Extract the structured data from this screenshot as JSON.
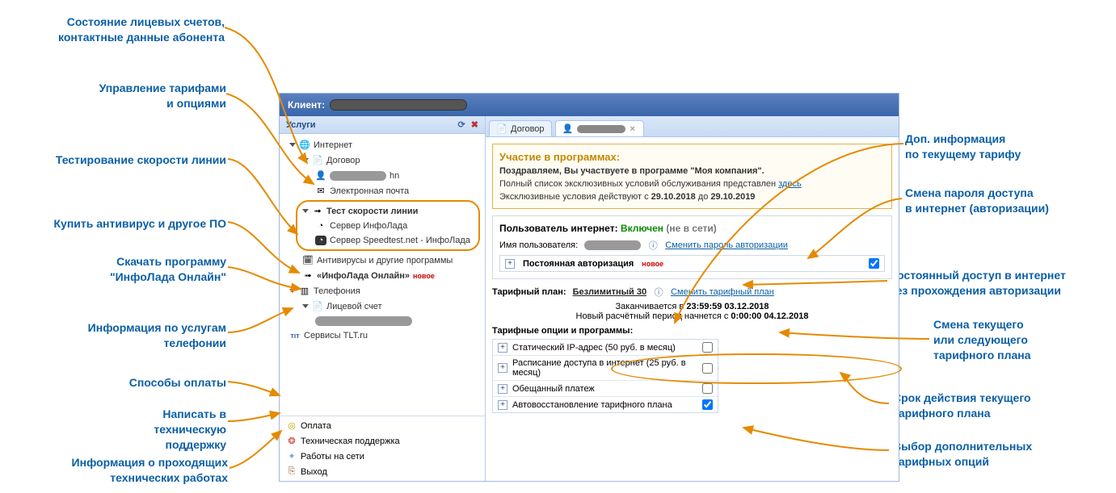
{
  "callouts": {
    "balance": "Состояние лицевых счетов,\nконтактные данные абонента",
    "tariffs": "Управление тарифами\nи опциями",
    "speedtest": "Тестирование скорости линии",
    "antivirus": "Купить антивирус и другое ПО",
    "download": "Скачать программу\n\"ИнфоЛада Онлайн\"",
    "telephony": "Информация по услугам\nтелефонии",
    "payment": "Способы оплаты",
    "support": "Написать в\nтехническую поддержку",
    "maint": "Информация о проходящих\nтехнических работах",
    "tariff_info": "Доп. информация\nпо текущему тарифу",
    "passchange": "Смена пароля доступа\nв интернет (авторизации)",
    "permauth": "Постоянный доступ в интернет\nбез прохождения авторизации",
    "changeplan": "Смена текущего\nили следующего\nтарифного плана",
    "validity": "Срок действия текущего\nтарифного плана",
    "options": "Выбор дополнительных\nтарифных опций"
  },
  "titlebar": {
    "label": "Клиент:"
  },
  "left": {
    "header": "Услуги",
    "internet": "Интернет",
    "contract": "Договор",
    "user_suffix": "hn",
    "email": "Электронная почта",
    "speed_header": "Тест скорости линии",
    "speed_srv1": "Сервер ИнфоЛада",
    "speed_srv2": "Сервер Speedtest.net - ИнфоЛада",
    "antivirus": "Антивирусы и другие программы",
    "infolada_online": "«ИнфоЛада Онлайн»",
    "new_badge": "новое",
    "telephony": "Телефония",
    "account": "Лицевой счет",
    "tlt": "Сервисы TLT.ru",
    "pay": "Оплата",
    "support": "Техническая поддержка",
    "works": "Работы на сети",
    "exit": "Выход"
  },
  "tabs": {
    "contract": "Договор"
  },
  "promo": {
    "title": "Участие в программах:",
    "line1_a": "Поздравляем, Вы участвуете в программе \"Моя компания\".",
    "line2_a": "Полный список эксклюзивных условий обслуживания представлен ",
    "line2_link": "здесь",
    "line3_a": "Эксклюзивные условия действуют с ",
    "date_from": "29.10.2018",
    "line3_b": " до ",
    "date_to": "29.10.2019"
  },
  "user_section": {
    "title_part1": "Пользователь интернет:  ",
    "status_on": "Включен",
    "status_note": " (не в сети)",
    "username_label": "Имя пользователя:",
    "change_pass": "Сменить пароль авторизации",
    "perm_auth": "Постоянная авторизация",
    "badge_new": "новое"
  },
  "tariff": {
    "title_label": "Тарифный план:",
    "name": "Безлимитный 30",
    "change_link": "Сменить тарифный план",
    "ends_label": "Заканчивается в ",
    "ends_value": "23:59:59 03.12.2018",
    "next_label": "Новый расчётный период начнется с ",
    "next_value": "0:00:00 04.12.2018",
    "opts_title": "Тарифные опции и программы:",
    "opts": [
      {
        "label": "Статический IP-адрес (50 руб. в месяц)",
        "checked": false
      },
      {
        "label": "Расписание доступа в интернет (25 руб. в месяц)",
        "checked": false
      },
      {
        "label": "Обещанный платеж",
        "checked": false
      },
      {
        "label": "Автовосстановление тарифного плана",
        "checked": true
      }
    ]
  }
}
